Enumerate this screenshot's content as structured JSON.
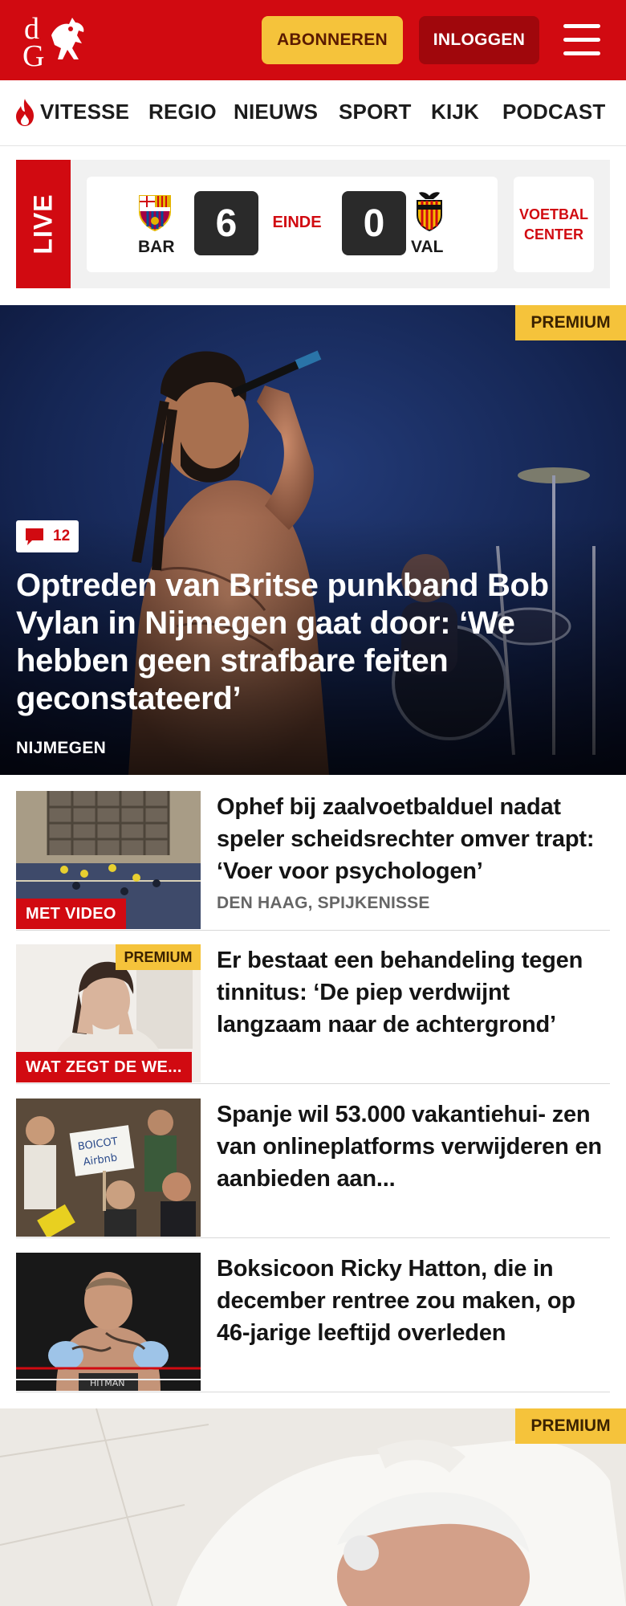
{
  "header": {
    "logo_text": "dG",
    "subscribe_label": "ABONNEREN",
    "login_label": "INLOGGEN"
  },
  "nav": {
    "items": [
      "VITESSE",
      "REGIO",
      "NIEUWS",
      "SPORT",
      "KIJK",
      "PODCAST"
    ]
  },
  "live": {
    "tab_label": "LIVE",
    "home": {
      "code": "BAR",
      "score": "6"
    },
    "away": {
      "code": "VAL",
      "score": "0"
    },
    "status": "EINDE",
    "voetbal_center": "VOETBAL CENTER"
  },
  "hero": {
    "premium": "PREMIUM",
    "comments": "12",
    "title": "Optreden van Britse punkband Bob Vylan in Nijmegen gaat door: ‘We hebben geen strafbare feiten geconstateerd’",
    "location": "NIJMEGEN"
  },
  "articles": [
    {
      "label": "MET VIDEO",
      "title": "Ophef bij zaalvoetbalduel nadat speler scheidsrechter omver trapt: ‘Voer voor psychologen’",
      "location": "DEN HAAG, SPIJKENISSE"
    },
    {
      "premium": "PREMIUM",
      "label": "WAT ZEGT DE WE...",
      "title": "Er bestaat een behandeling tegen tinnitus: ‘De piep verdwijnt langzaam naar de achtergrond’"
    },
    {
      "title": "Spanje wil 53.000 vakantiehui- zen van onlineplatforms verwijderen en aanbieden aan..."
    },
    {
      "title": "Boksicoon Ricky Hatton, die in december rentree zou maken, op 46-jarige leeftijd overleden"
    }
  ],
  "hero2": {
    "premium": "PREMIUM"
  },
  "colors": {
    "brand_red": "#d10a11",
    "premium_yellow": "#f5c33b",
    "login_dark_red": "#a0070c"
  }
}
